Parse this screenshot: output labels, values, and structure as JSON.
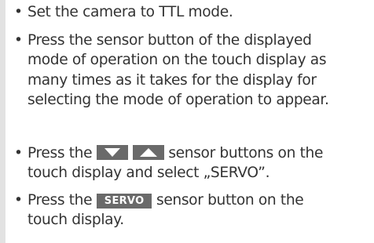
{
  "bullet_glyph": "•",
  "items": [
    {
      "lines": [
        "Set the camera to TTL mode."
      ]
    },
    {
      "lines": [
        "Press the sensor button of the displayed",
        "mode of operation on the touch display as",
        "many times as it takes for the display for",
        "selecting the mode of operation to appear."
      ]
    },
    {
      "line1_before": "Press the",
      "line1_after": "sensor buttons on the",
      "line2": "touch display and select „SERVO”.",
      "button_icons": [
        "down-arrow-icon",
        "up-arrow-icon"
      ]
    },
    {
      "line1_before": "Press the",
      "button_label": "SERVO",
      "line1_after": "sensor button on the",
      "line2": "touch display."
    }
  ],
  "colors": {
    "text": "#333333",
    "sensor_button": "#6a6a6a",
    "left_rule": "#e2e2e2"
  }
}
